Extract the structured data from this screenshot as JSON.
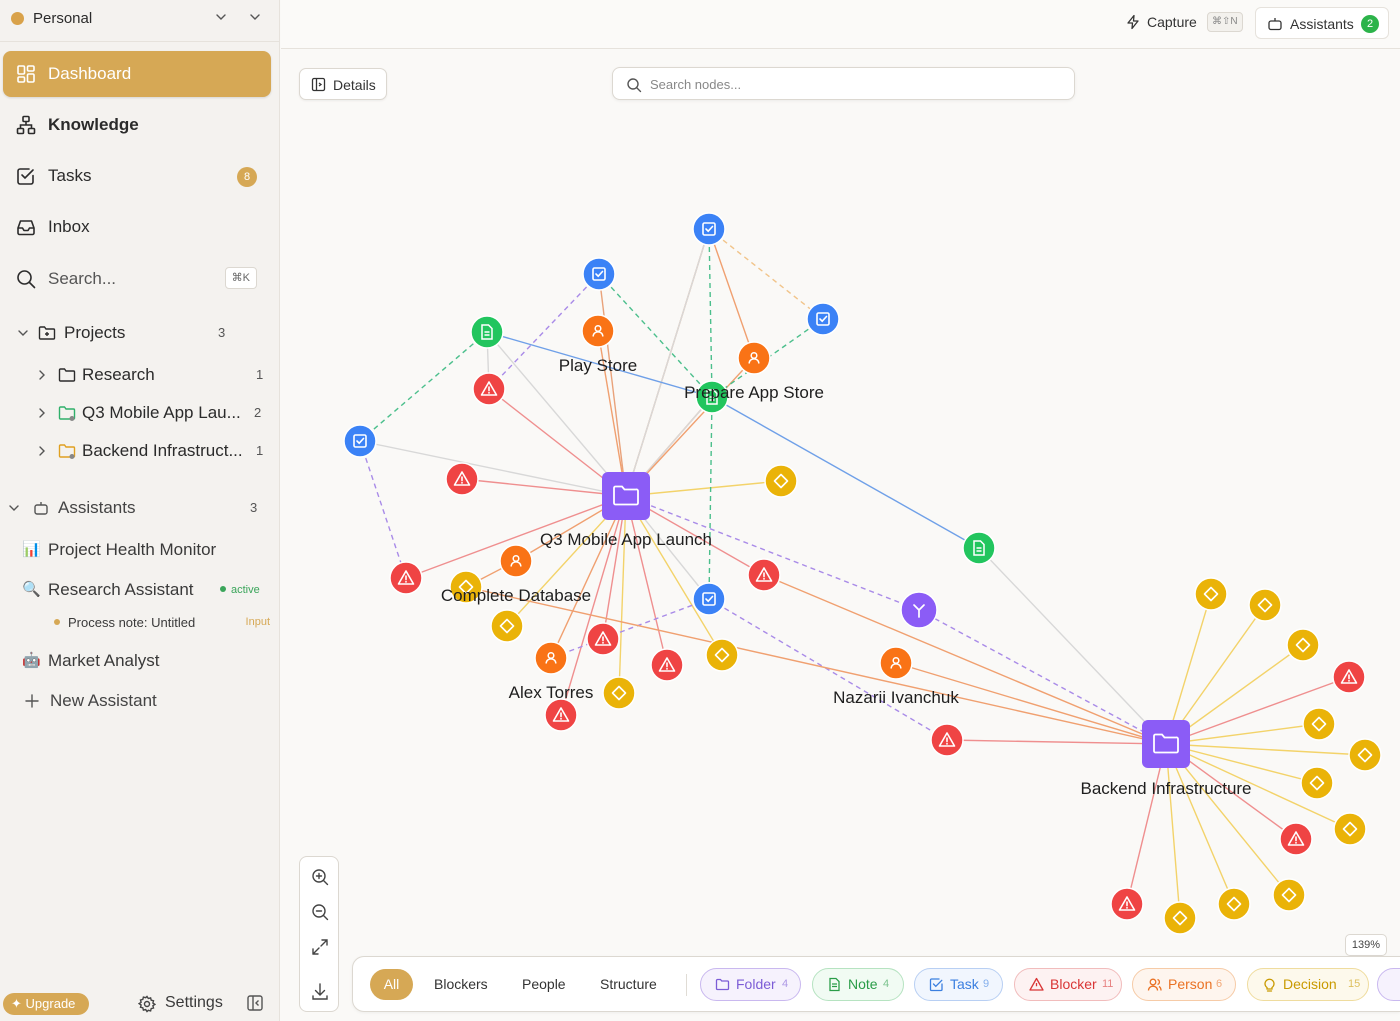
{
  "workspace": {
    "name": "Personal"
  },
  "nav": [
    {
      "label": "Dashboard",
      "icon": "dashboard-icon"
    },
    {
      "label": "Knowledge",
      "icon": "knowledge-icon"
    },
    {
      "label": "Tasks",
      "icon": "tasks-icon",
      "badge": "8"
    },
    {
      "label": "Inbox",
      "icon": "inbox-icon"
    },
    {
      "label": "Search...",
      "icon": "search-icon",
      "shortcut": "⌘K"
    }
  ],
  "projects": {
    "label": "Projects",
    "count": "3",
    "items": [
      {
        "label": "Research",
        "count": "1"
      },
      {
        "label": "Q3 Mobile App Lau...",
        "count": "2"
      },
      {
        "label": "Backend Infrastruct...",
        "count": "1"
      }
    ]
  },
  "assistants": {
    "label": "Assistants",
    "count": "3",
    "items": [
      {
        "label": "Project Health Monitor",
        "emoji": "📊"
      },
      {
        "label": "Research Assistant",
        "emoji": "🔍",
        "status": "active"
      },
      {
        "label": "Market Analyst",
        "emoji": "🤖"
      }
    ],
    "process": {
      "label": "Process note: Untitled",
      "tag": "Input"
    },
    "new_label": "New Assistant"
  },
  "footer": {
    "upgrade": "Upgrade",
    "settings": "Settings"
  },
  "topbar": {
    "capture": "Capture",
    "capture_shortcut": "⌘⇧N",
    "assistants": "Assistants",
    "assistants_count": "2"
  },
  "toolbar": {
    "details": "Details",
    "search_placeholder": "Search nodes..."
  },
  "zoom_level": "139%",
  "filters": {
    "tabs": [
      "All",
      "Blockers",
      "People",
      "Structure"
    ],
    "chips": [
      {
        "label": "Folder",
        "count": "4",
        "color": "#7c5cd6"
      },
      {
        "label": "Note",
        "count": "4",
        "color": "#2cb34a"
      },
      {
        "label": "Task",
        "count": "9",
        "color": "#3b7fe0"
      },
      {
        "label": "Blocker",
        "count": "11",
        "color": "#e23b3b"
      },
      {
        "label": "Person",
        "count": "6",
        "color": "#ef7a22"
      },
      {
        "label": "Decision",
        "count": "15",
        "color": "#d4a300"
      }
    ]
  },
  "colors": {
    "folder": "#8b5cf6",
    "note": "#22c55e",
    "task": "#3b82f6",
    "blocker": "#ef4444",
    "person": "#f97316",
    "decision": "#eab308",
    "topic": "#8b5cf6"
  },
  "graph": {
    "labels": {
      "q3": "Q3 Mobile App Launch",
      "backend": "Backend Infrastructure",
      "play": "Play Store",
      "appstore": "Prepare App Store",
      "db": "Complete Database",
      "alex": "Alex Torres",
      "nazarii": "Nazarii Ivanchuk"
    }
  }
}
